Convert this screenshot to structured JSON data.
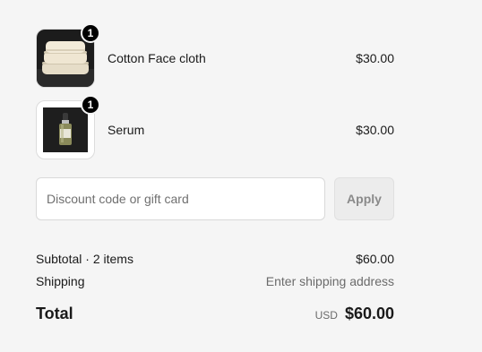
{
  "order": {
    "items": [
      {
        "name": "Cotton Face cloth",
        "price": "$30.00",
        "quantity": "1",
        "image_icon": "folded-towels-photo"
      },
      {
        "name": "Serum",
        "price": "$30.00",
        "quantity": "1",
        "image_icon": "serum-bottle-photo"
      }
    ]
  },
  "discount": {
    "placeholder": "Discount code or gift card",
    "value": "",
    "apply_label": "Apply"
  },
  "totals": {
    "subtotal_label": "Subtotal · 2 items",
    "subtotal_value": "$60.00",
    "shipping_label": "Shipping",
    "shipping_value": "Enter shipping address",
    "total_label": "Total",
    "currency": "USD",
    "total_value": "$60.00"
  },
  "colors": {
    "background": "#f5f5f5",
    "badge": "#000000",
    "muted_text": "#6b6b6b"
  }
}
